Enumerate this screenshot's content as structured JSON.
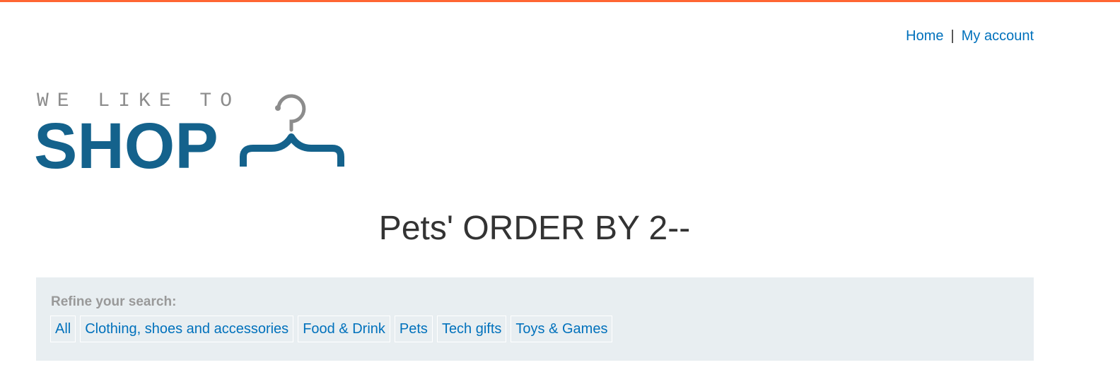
{
  "nav": {
    "home_label": "Home",
    "separator": "|",
    "account_label": "My account"
  },
  "logo": {
    "top_text": "WE LIKE TO",
    "main_text": "SHOP"
  },
  "page_title": "Pets' ORDER BY 2--",
  "filter": {
    "label": "Refine your search:",
    "categories": [
      "All",
      "Clothing, shoes and accessories",
      "Food & Drink",
      "Pets",
      "Tech gifts",
      "Toys & Games"
    ]
  },
  "colors": {
    "accent_border": "#ff6633",
    "link": "#0071bc",
    "logo_blue": "#14628c",
    "logo_gray": "#8c8c8c",
    "panel_bg": "#e8eef1"
  }
}
